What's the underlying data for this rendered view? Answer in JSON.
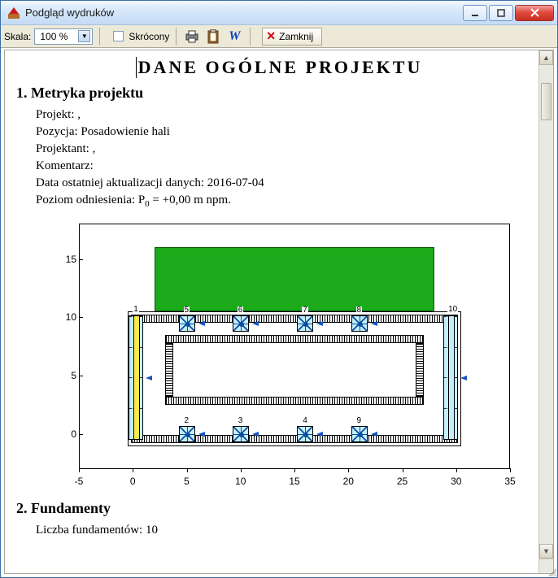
{
  "window": {
    "title": "Podgląd wydruków"
  },
  "toolbar": {
    "scale_label": "Skala:",
    "scale_value": "100 %",
    "short_label": "Skrócony",
    "close_label": "Zamknij"
  },
  "doc": {
    "main_title": "DANE  OGÓLNE  PROJEKTU",
    "section1_title": "1. Metryka projektu",
    "project_label": "Projekt:  ,",
    "position_label": "Pozycja:  Posadowienie hali",
    "designer_label": "Projektant:  ,",
    "comment_label": "Komentarz:",
    "date_label": "Data ostatniej aktualizacji danych:  2016-07-04",
    "ref_level_prefix": "Poziom odniesienia:  P",
    "ref_level_sub": "0",
    "ref_level_suffix": " = +0,00 m npm.",
    "section2_title": "2. Fundamenty",
    "found_count_label": "Liczba fundamentów:  10"
  },
  "chart_data": {
    "type": "scatter",
    "title": "",
    "xlabel": "",
    "ylabel": "",
    "xlim": [
      -5,
      35
    ],
    "ylim": [
      -3,
      18
    ],
    "x_ticks": [
      -5,
      0,
      5,
      10,
      15,
      20,
      25,
      30,
      35
    ],
    "y_ticks": [
      0,
      5,
      10,
      15
    ],
    "building_rect": {
      "x0": 2,
      "y0": 10.5,
      "x1": 28,
      "y1": 16
    },
    "footprint_outer": {
      "x0": -0.5,
      "y0": -1,
      "x1": 30.5,
      "y1": 10.5
    },
    "footprint_inner": {
      "x0": 3,
      "y0": 2.5,
      "x1": 27,
      "y1": 8.5
    },
    "column_foundations": [
      {
        "id": 1,
        "x": 0.3,
        "y0": -0.5,
        "y1": 10.2,
        "style": "yellow"
      },
      {
        "id": 10,
        "x": 29.5,
        "y0": -0.5,
        "y1": 10.2,
        "style": "blue"
      }
    ],
    "square_foundations": [
      {
        "id": 2,
        "x": 5,
        "y": 0
      },
      {
        "id": 3,
        "x": 10,
        "y": 0
      },
      {
        "id": 4,
        "x": 16,
        "y": 0
      },
      {
        "id": 9,
        "x": 21,
        "y": 0
      },
      {
        "id": 5,
        "x": 5,
        "y": 9.5
      },
      {
        "id": 6,
        "x": 10,
        "y": 9.5
      },
      {
        "id": 7,
        "x": 16,
        "y": 9.5
      },
      {
        "id": 8,
        "x": 21,
        "y": 9.5
      }
    ]
  }
}
